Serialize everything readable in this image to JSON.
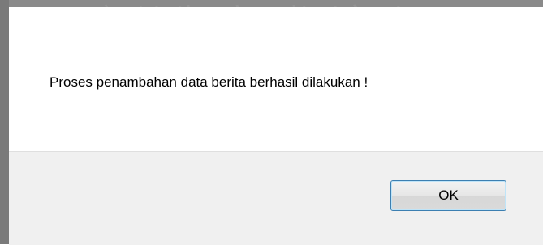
{
  "dialog": {
    "message": "Proses penambahan data berita berhasil dilakukan !",
    "ok_label": "OK"
  },
  "colors": {
    "frame": "#7a7a7a",
    "button_area": "#f0f0f0",
    "button_border": "#3c7fb1"
  }
}
